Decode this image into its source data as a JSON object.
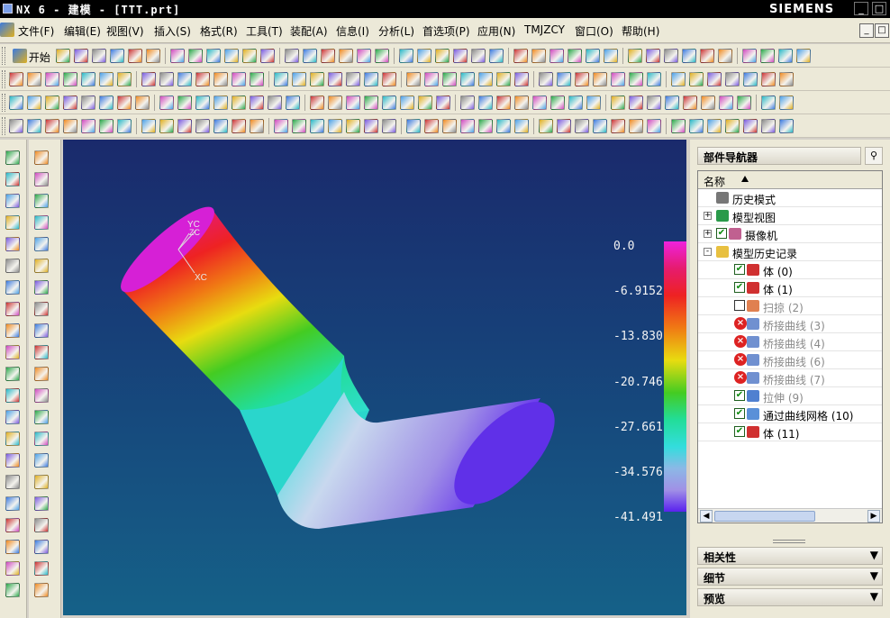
{
  "window": {
    "title": "NX 6 - 建模 - [TTT.prt]",
    "brand": "SIEMENS",
    "controls": [
      "_",
      "□"
    ]
  },
  "menu": {
    "items": [
      "文件(F)",
      "编辑(E)",
      "视图(V)",
      "插入(S)",
      "格式(R)",
      "工具(T)",
      "装配(A)",
      "信息(I)",
      "分析(L)",
      "首选项(P)",
      "应用(N)",
      "TMJZCY",
      "窗口(O)",
      "帮助(H)"
    ],
    "mdi_controls": [
      "_",
      "□"
    ]
  },
  "toolbar": {
    "start_label": "开始"
  },
  "legend": {
    "values": [
      "0.0",
      "-6.9152",
      "-13.830",
      "-20.746",
      "-27.661",
      "-34.576",
      "-41.491"
    ],
    "colors": [
      "#ee22dd",
      "#ee2222",
      "#e8dc10",
      "#44cc22",
      "#33dddd",
      "#a090e6",
      "#5a22ee"
    ]
  },
  "axis": {
    "yc": "YC",
    "zc": "ZC",
    "xc": "XC"
  },
  "navigator": {
    "title": "部件导航器",
    "column_name": "名称",
    "items": [
      {
        "label": "历史模式",
        "icon": "clock-icon"
      },
      {
        "label": "模型视图",
        "icon": "model-view-icon"
      },
      {
        "label": "摄像机",
        "icon": "camera-icon"
      },
      {
        "label": "模型历史记录",
        "icon": "folder-icon"
      },
      {
        "label": "体 (0)",
        "icon": "body-icon"
      },
      {
        "label": "体 (1)",
        "icon": "body-icon"
      },
      {
        "label": "扫掠 (2)",
        "icon": "sweep-icon"
      },
      {
        "label": "桥接曲线 (3)",
        "icon": "bridge-curve-icon"
      },
      {
        "label": "桥接曲线 (4)",
        "icon": "bridge-curve-icon"
      },
      {
        "label": "桥接曲线 (6)",
        "icon": "bridge-curve-icon"
      },
      {
        "label": "桥接曲线 (7)",
        "icon": "bridge-curve-icon"
      },
      {
        "label": "拉伸 (9)",
        "icon": "extrude-icon"
      },
      {
        "label": "通过曲线网格 (10)",
        "icon": "through-curve-mesh-icon"
      },
      {
        "label": "体 (11)",
        "icon": "body-icon"
      }
    ],
    "panels": [
      "相关性",
      "细节",
      "预览"
    ]
  },
  "colors": {
    "viewport_top": "#1a2a6c",
    "viewport_bottom": "#156188",
    "accent": "#0a8a0a"
  }
}
